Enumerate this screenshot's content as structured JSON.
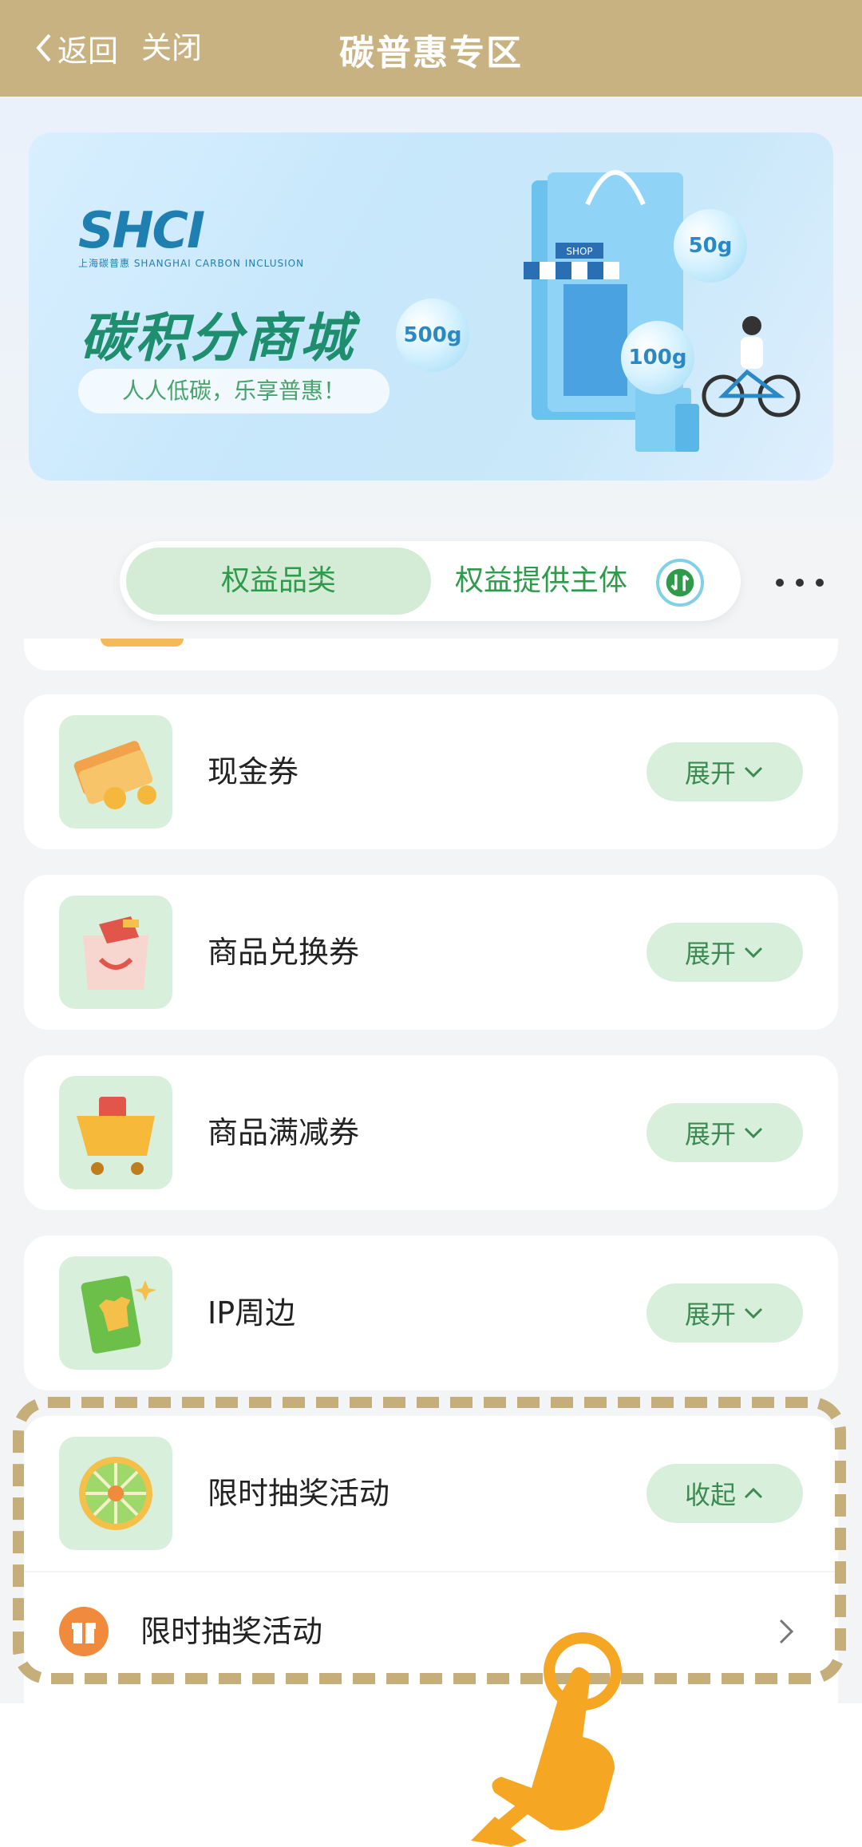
{
  "header": {
    "back_label": "返回",
    "close_label": "关闭",
    "title": "碳普惠专区"
  },
  "banner": {
    "logo_text": "SHCI",
    "logo_subtitle": "上海碳普惠 SHANGHAI CARBON INCLUSION",
    "title": "碳积分商城",
    "slogan": "人人低碳，乐享普惠！",
    "bubbles": [
      "500g",
      "50g",
      "100g"
    ],
    "shop_sign": "SHOP"
  },
  "tabs": {
    "active": "权益品类",
    "other": "权益提供主体"
  },
  "categories": [
    {
      "label": "现金券",
      "toggle": "展开",
      "icon": "cash-voucher-icon"
    },
    {
      "label": "商品兑换券",
      "toggle": "展开",
      "icon": "gift-bag-icon"
    },
    {
      "label": "商品满减券",
      "toggle": "展开",
      "icon": "shopping-cart-icon"
    },
    {
      "label": "IP周边",
      "toggle": "展开",
      "icon": "ip-merch-book-icon"
    },
    {
      "label": "限时抽奖活动",
      "toggle": "收起",
      "icon": "lottery-wheel-icon"
    }
  ],
  "sub_item": {
    "label": "限时抽奖活动"
  },
  "colors": {
    "header_bg": "#c8b282",
    "accent_green": "#2f9a4a",
    "toggle_bg": "#d8efdb",
    "highlight_border": "#c6ae7a",
    "hand": "#f5a623"
  }
}
